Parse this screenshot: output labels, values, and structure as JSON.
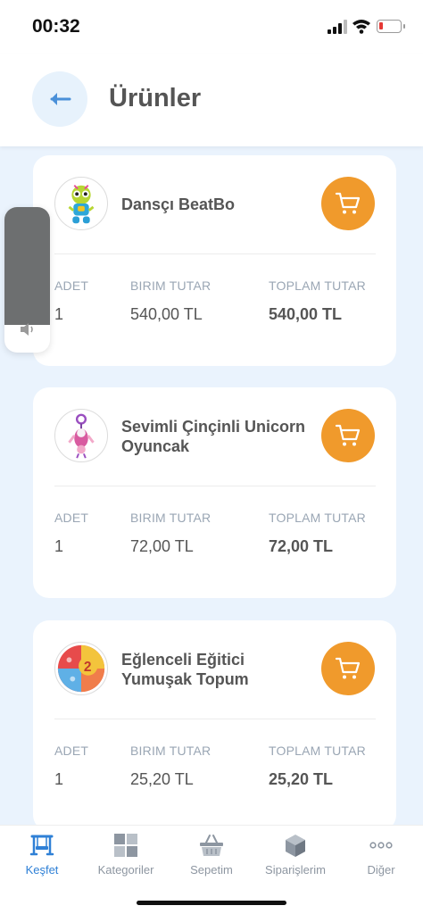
{
  "status_bar": {
    "time": "00:32"
  },
  "header": {
    "title": "Ürünler"
  },
  "columns": {
    "qty": "ADET",
    "unit_price": "BIRIM TUTAR",
    "total": "TOPLAM TUTAR"
  },
  "products": [
    {
      "name": "Dansçı BeatBo",
      "qty": "1",
      "unit_price": "540,00 TL",
      "total": "540,00 TL"
    },
    {
      "name": "Sevimli Çinçinli Unicorn Oyuncak",
      "qty": "1",
      "unit_price": "72,00 TL",
      "total": "72,00 TL"
    },
    {
      "name": "Eğlenceli Eğitici Yumuşak Topum",
      "qty": "1",
      "unit_price": "25,20 TL",
      "total": "25,20 TL"
    }
  ],
  "tabs": [
    {
      "label": "Keşfet",
      "icon": "swing-icon",
      "active": true
    },
    {
      "label": "Kategoriler",
      "icon": "grid-icon",
      "active": false
    },
    {
      "label": "Sepetim",
      "icon": "basket-icon",
      "active": false
    },
    {
      "label": "Siparişlerim",
      "icon": "box-icon",
      "active": false
    },
    {
      "label": "Diğer",
      "icon": "more-icon",
      "active": false
    }
  ],
  "volume": {
    "level": 0.81
  },
  "colors": {
    "accent": "#2f80d6",
    "cart": "#f09a2c",
    "background": "#eaf3fd"
  }
}
